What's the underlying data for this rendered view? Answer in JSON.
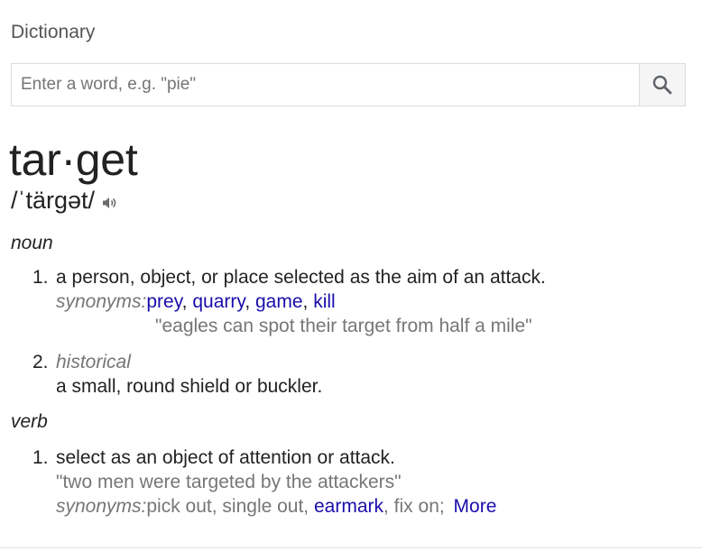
{
  "header": {
    "title": "Dictionary"
  },
  "search": {
    "placeholder": "Enter a word, e.g. \"pie\"",
    "icon": "search-icon"
  },
  "entry": {
    "word": "tar·get",
    "phonetic": "/ˈtärɡət/",
    "audio_icon": "speaker-icon"
  },
  "noun": {
    "label": "noun",
    "senses": [
      {
        "number": "1.",
        "definition": "a person, object, or place selected as the aim of an attack.",
        "synonyms_label": "synonyms:",
        "synonyms": [
          "prey",
          "quarry",
          "game",
          "kill"
        ],
        "separator": ", ",
        "example": "\"eagles can spot their target from half a mile\""
      },
      {
        "number": "2.",
        "register": "historical",
        "definition": "a small, round shield or buckler."
      }
    ]
  },
  "verb": {
    "label": "verb",
    "senses": [
      {
        "number": "1.",
        "definition": "select as an object of attention or attack.",
        "example": "\"two men were targeted by the attackers\"",
        "synonyms_label": "synonyms:",
        "syn_plain_1": "pick out, single out, ",
        "syn_link_1": "earmark",
        "syn_plain_2": ", fix on; ",
        "more": "More"
      }
    ]
  },
  "colors": {
    "link": "#1a0dab",
    "muted": "#767676",
    "text": "#222222"
  }
}
